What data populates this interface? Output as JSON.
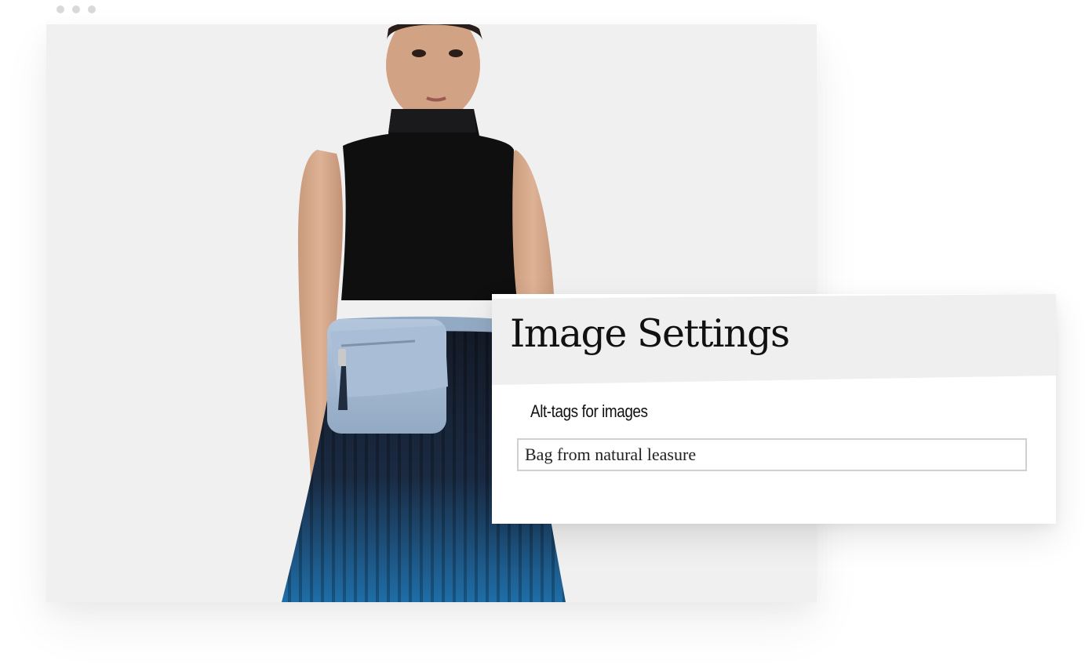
{
  "window": {
    "controls": [
      "dot",
      "dot",
      "dot"
    ]
  },
  "image_settings": {
    "title": "Image Settings",
    "alt_label": "Alt-tags for images",
    "alt_value": "Bag from natural leasure"
  }
}
